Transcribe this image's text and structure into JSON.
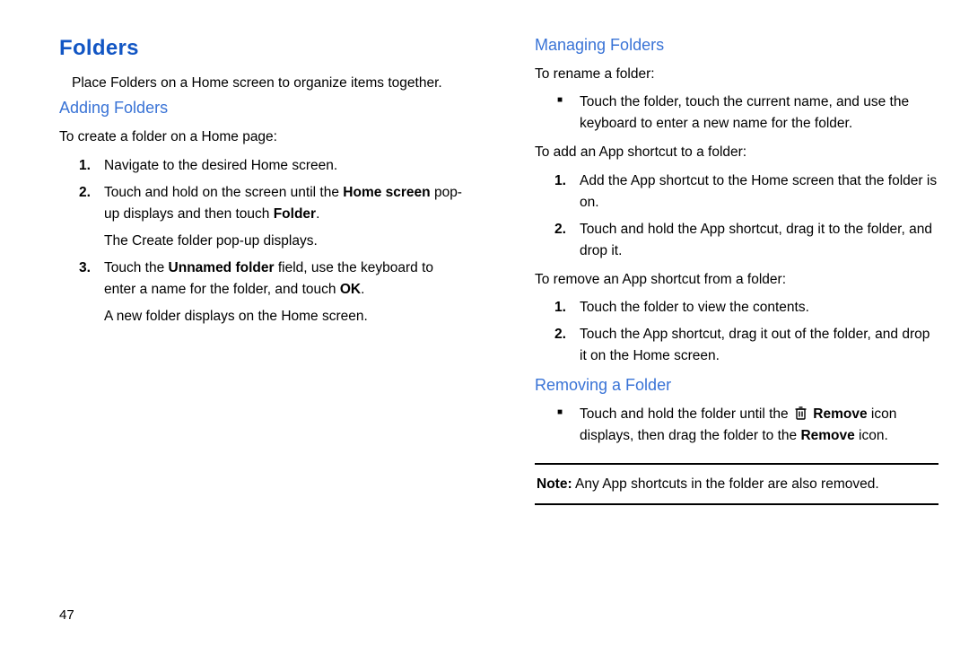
{
  "pageNumber": "47",
  "left": {
    "mainHeading": "Folders",
    "intro": "Place Folders on a Home screen to organize items together.",
    "addingHeading": "Adding Folders",
    "addingLead": "To create a folder on a Home page:",
    "step1_num": "1.",
    "step1_text": "Navigate to the desired Home screen.",
    "step2_num": "2.",
    "step2_a": "Touch and hold on the screen until the ",
    "step2_b_bold": "Home screen",
    "step2_c": " pop-up displays and then touch ",
    "step2_d_bold": "Folder",
    "step2_e": ".",
    "step2_sub": "The Create folder pop-up displays.",
    "step3_num": "3.",
    "step3_a": "Touch the ",
    "step3_b_bold": "Unnamed folder",
    "step3_c": " field, use the keyboard to enter a name for the folder, and touch ",
    "step3_d_bold": "OK",
    "step3_e": ".",
    "step3_sub": "A new folder displays on the Home screen."
  },
  "right": {
    "managingHeading": "Managing Folders",
    "renameLead": "To rename a folder:",
    "renameBullet": "Touch the folder, touch the current name, and use the keyboard to enter a new name for the folder.",
    "addLead": "To add an App shortcut to a folder:",
    "add1_num": "1.",
    "add1_text": "Add the App shortcut to the Home screen that the folder is on.",
    "add2_num": "2.",
    "add2_text": "Touch and hold the App shortcut, drag it to the folder, and drop it.",
    "removeLead": "To remove an App shortcut from a folder:",
    "rem1_num": "1.",
    "rem1_text": "Touch the folder to view the contents.",
    "rem2_num": "2.",
    "rem2_text": "Touch the App shortcut, drag it out of the folder, and drop it on the Home screen.",
    "removingHeading": "Removing a Folder",
    "removing_a": "Touch and hold the folder until the ",
    "removing_b_bold": "Remove",
    "removing_c": " icon displays, then drag the folder to the ",
    "removing_d_bold": "Remove",
    "removing_e": " icon.",
    "note_label": "Note:",
    "note_text": " Any App shortcuts in the folder are also removed."
  }
}
